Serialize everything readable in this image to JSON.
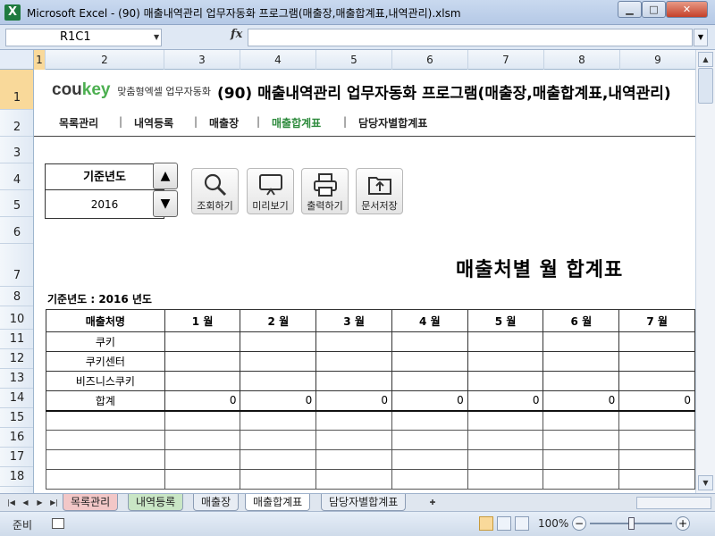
{
  "window": {
    "title": "Microsoft Excel - (90) 매출내역관리 업무자동화 프로그램(매출장,매출합계표,내역관리).xlsm",
    "app_icon": "X",
    "min_glyph": "▁",
    "max_glyph": "□",
    "close_glyph": "✕"
  },
  "formula_bar": {
    "name_box": "R1C1",
    "fx_label": "fx",
    "formula": ""
  },
  "columns": [
    "1",
    "2",
    "3",
    "4",
    "5",
    "6",
    "7",
    "8",
    "9"
  ],
  "rows": [
    "1",
    "2",
    "3",
    "4",
    "5",
    "6",
    "7",
    "8",
    "10",
    "11",
    "12",
    "13",
    "14",
    "15",
    "16",
    "17",
    "18"
  ],
  "brand": {
    "name_start": "cou",
    "name_accent": "key",
    "tagline": "맞춤형엑셀 업무자동화"
  },
  "doc_title": "(90) 매출내역관리 업무자동화 프로그램(매출장,매출합계표,내역관리)",
  "nav": {
    "items": [
      "목록관리",
      "내역등록",
      "매출장",
      "매출합계표",
      "담당자별합계표"
    ],
    "active": "매출합계표",
    "separator": "|"
  },
  "year_selector": {
    "label": "기준년도",
    "value": "2016",
    "up_glyph": "▲",
    "down_glyph": "▼"
  },
  "toolbar": {
    "search_label": "조회하기",
    "preview_label": "미리보기",
    "print_label": "출력하기",
    "save_label": "문서저장"
  },
  "report": {
    "title": "매출처별 월 합계표",
    "base_year_note": "기준년도 : 2016 년도",
    "headers": [
      "매출처명",
      "1 월",
      "2 월",
      "3 월",
      "4 월",
      "5 월",
      "6 월",
      "7 월"
    ],
    "rows": [
      {
        "name": "쿠키",
        "values": [
          "",
          "",
          "",
          "",
          "",
          "",
          ""
        ]
      },
      {
        "name": "쿠키센터",
        "values": [
          "",
          "",
          "",
          "",
          "",
          "",
          ""
        ]
      },
      {
        "name": "비즈니스쿠키",
        "values": [
          "",
          "",
          "",
          "",
          "",
          "",
          ""
        ]
      }
    ],
    "total": {
      "name": "합계",
      "values": [
        "0",
        "0",
        "0",
        "0",
        "0",
        "0",
        "0"
      ]
    }
  },
  "sheet_tabs": {
    "tabs": [
      "목록관리",
      "내역등록",
      "매출장",
      "매출합계표",
      "담당자별합계표"
    ],
    "active": "매출합계표"
  },
  "status": {
    "text": "준비",
    "zoom": "100%"
  }
}
